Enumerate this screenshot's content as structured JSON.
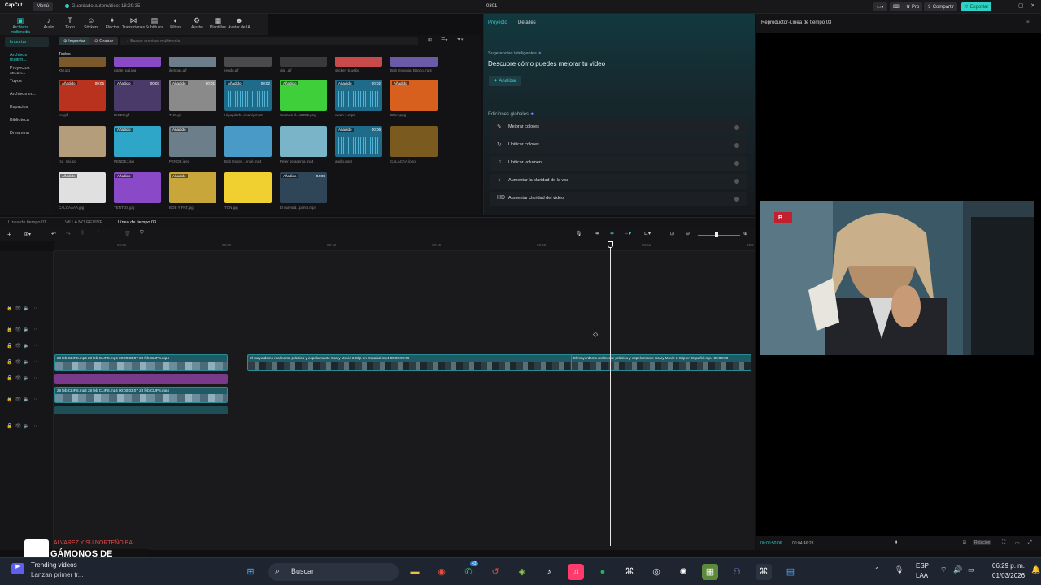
{
  "topbar": {
    "logo": "CapCut",
    "menu": "Menú",
    "autosave": "Guardado automático: 18:29:35",
    "project": "0301",
    "pro": "Pro",
    "share": "Compartir",
    "export": "Exportar"
  },
  "tools": [
    {
      "label": "Archivos multimedia",
      "icon": "▣"
    },
    {
      "label": "Audio",
      "icon": "♪"
    },
    {
      "label": "Texto",
      "icon": "T"
    },
    {
      "label": "Stickers",
      "icon": "☺"
    },
    {
      "label": "Efectos",
      "icon": "✦"
    },
    {
      "label": "Transiciones",
      "icon": "⋈"
    },
    {
      "label": "Subtítulos",
      "icon": "▤"
    },
    {
      "label": "Filtros",
      "icon": "◐"
    },
    {
      "label": "Ajuste",
      "icon": "⚙"
    },
    {
      "label": "Plantillas",
      "icon": "▦"
    },
    {
      "label": "Avatar de IA",
      "icon": "☻"
    }
  ],
  "leftnav": [
    "Importar",
    "Archivos multim...",
    "Proyectos secun...",
    "Tuyos",
    "Archivos m...",
    "Espacios",
    "Biblioteca",
    "Dreamina"
  ],
  "media": {
    "import": "Importar",
    "record": "Grabar",
    "search_placeholder": "Buscar archivos multimedia",
    "all": "Todos",
    "row0": [
      "XM.jpg",
      "rotate_pal.jpg",
      "ilembas.gif",
      "rendo.gif",
      "ola_.gif",
      "sticker_5.webp",
      "Bob Esponja_Banco.mp4"
    ],
    "grid": [
      {
        "name": "en.gif",
        "badge": "Añadido",
        "dur": "00:05",
        "color": "#b8321e"
      },
      {
        "name": "DICEP.gif",
        "badge": "Añadido",
        "dur": "00:03",
        "color": "#4a3a6a"
      },
      {
        "name": "TNS.gif",
        "badge": "Añadido",
        "dur": "00:01",
        "color": "#8a8a8a"
      },
      {
        "name": "Hipopótch...imaniy.mp3",
        "badge": "Añadido",
        "dur": "00:02",
        "color": "#1e6b8a"
      },
      {
        "name": "Captura d...43962.png",
        "badge": "Añadido",
        "dur": "",
        "color": "#3fcf3a"
      },
      {
        "name": "woah-1.mp3",
        "badge": "Añadido",
        "dur": "00:02",
        "color": "#1e6b8a"
      },
      {
        "name": "BISA.png",
        "badge": "Añadido",
        "dur": "",
        "color": "#d8601e"
      },
      {
        "name": "rsa_nai.jpg",
        "badge": "",
        "dur": "",
        "color": "#b49d7a"
      },
      {
        "name": "PENDEJ.jpg",
        "badge": "Añadido",
        "dur": "",
        "color": "#2ea6c8"
      },
      {
        "name": "PENDE.jpeg",
        "badge": "Añadido",
        "dur": "",
        "color": "#6b7e8a"
      },
      {
        "name": "Bob Espon...ensé.mp4",
        "badge": "",
        "dur": "",
        "color": "#4a9ac8"
      },
      {
        "name": "Peter se acerca.mp4",
        "badge": "",
        "dur": "",
        "color": "#7ab4c8"
      },
      {
        "name": "audio.mp3",
        "badge": "Añadido",
        "dur": "00:06",
        "color": "#1e6b8a"
      },
      {
        "name": "CALACAA.jpeg",
        "badge": "",
        "dur": "",
        "color": "#7a5a1e"
      },
      {
        "name": "CALCAAAA.jpg",
        "badge": "Añadido",
        "dur": "",
        "color": "#e0e0e0"
      },
      {
        "name": "TENTOS.jpg",
        "badge": "Añadido",
        "dur": "",
        "color": "#8a4ac8"
      },
      {
        "name": "BOB Y PAT.jpg",
        "badge": "Añadido",
        "dur": "",
        "color": "#c8a63a"
      },
      {
        "name": "TON.jpg",
        "badge": "",
        "dur": "",
        "color": "#f0d030"
      },
      {
        "name": "El mayord...pañol.mp4",
        "badge": "Añadido",
        "dur": "04:08",
        "color": "#2f4658"
      }
    ]
  },
  "project_panel": {
    "tab_project": "Proyecto",
    "tab_details": "Detalles",
    "smart_label": "Sugerencias inteligentes",
    "headline": "Descubre cómo puedes mejorar tu video",
    "analyze": "Analizar",
    "global_label": "Ediciones globales",
    "options": [
      {
        "label": "Mejorar colores",
        "icon": "✎"
      },
      {
        "label": "Unificar colores",
        "icon": "↻"
      },
      {
        "label": "Unificar volumen",
        "icon": "♫"
      },
      {
        "label": "Aumentar la claridad de la voz",
        "icon": "✧"
      },
      {
        "label": "Aumentar claridad del video",
        "icon": "HD"
      }
    ]
  },
  "player": {
    "title": "Reproductor-Línea de tiempo 03",
    "current_time": "00:00:50:06",
    "total_time": "00:04:46:28",
    "ratio": "Relación"
  },
  "timeline": {
    "tabs": [
      "Línea de tiempo 01",
      "VILLA NO REVIVE",
      "Línea de tiempo 03"
    ],
    "ruler": [
      "00:36",
      "00:39",
      "00:42",
      "00:45",
      "00:48",
      "00:51",
      "00:5"
    ],
    "clips_v1a": "28 feb CLIPS.mp4 28 feb CLIPS.mp4 00:00:03:07 28 feb CLIPS.mp4",
    "clips_v1b": "El mayordomo realmente práctico y espeluznante  Scary Movie 2  Clip en Español.mp4  00:00:09:06",
    "clips_v1c": "El mayordomo realmente práctico y espeluznante  Scary Movie 2  Clip en Español.mp4  00:00:03",
    "clips_v2a": "28 feb CLIPS.mp4 28 feb CLIPS.mp4 00:00:03:07 28 feb CLIPS.mp4"
  },
  "overlay": {
    "line1": "ALVAREZ Y SU NORTEÑO BA",
    "line2": "GÁMONOS DE ACUERI"
  },
  "taskbar": {
    "news_title": "Trending videos",
    "news_sub": "Lanzan primer tr...",
    "search": "Buscar",
    "lang1": "ESP",
    "lang2": "LAA",
    "time": "06:29 p. m.",
    "date": "01/03/2026",
    "whatsapp_badge": "43"
  }
}
